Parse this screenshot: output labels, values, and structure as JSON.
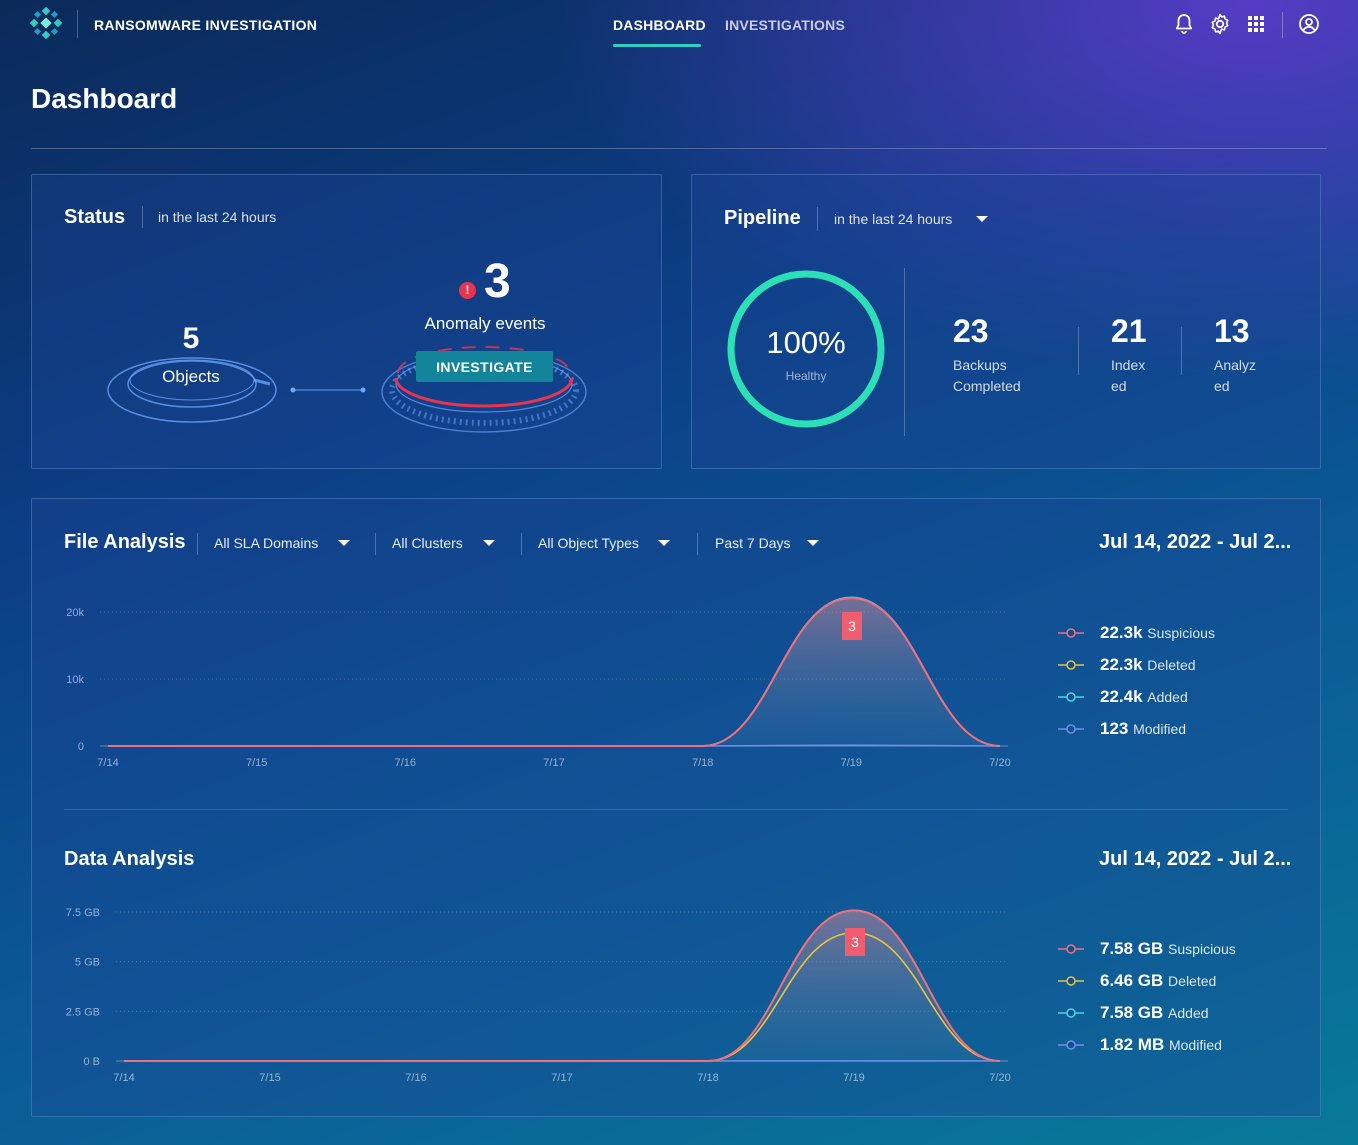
{
  "header": {
    "app_title": "RANSOMWARE INVESTIGATION",
    "tabs": [
      {
        "label": "DASHBOARD",
        "active": true
      },
      {
        "label": "INVESTIGATIONS",
        "active": false
      }
    ],
    "icons": [
      "bell-icon",
      "gear-icon",
      "apps-grid-icon",
      "user-account-icon"
    ]
  },
  "page": {
    "title": "Dashboard"
  },
  "status": {
    "title": "Status",
    "period": "in the last 24 hours",
    "objects_count": "5",
    "objects_label": "Objects",
    "anomaly_alert": "!",
    "anomaly_count": "3",
    "anomaly_label": "Anomaly events",
    "investigate_label": "INVESTIGATE"
  },
  "pipeline": {
    "title": "Pipeline",
    "period": "in the last 24 hours",
    "health_percent": "100%",
    "health_fraction": 1.0,
    "health_label": "Healthy",
    "stats": [
      {
        "value": "23",
        "label_line1": "Backups",
        "label_line2": "Completed"
      },
      {
        "value": "21",
        "label_line1": "Index",
        "label_line2": "ed"
      },
      {
        "value": "13",
        "label_line1": "Analyz",
        "label_line2": "ed"
      }
    ]
  },
  "filters": {
    "sla": "All SLA Domains",
    "clusters": "All Clusters",
    "object_types": "All Object Types",
    "period": "Past 7 Days"
  },
  "file_analysis": {
    "title": "File Analysis",
    "date_range": "Jul 14, 2022 - Jul 2...",
    "marker": "3",
    "legend": [
      {
        "value": "22.3k",
        "name": "Suspicious",
        "color": "#ef6f7d"
      },
      {
        "value": "22.3k",
        "name": "Deleted",
        "color": "#e9c23d"
      },
      {
        "value": "22.4k",
        "name": "Added",
        "color": "#49d4e6"
      },
      {
        "value": "123",
        "name": "Modified",
        "color": "#6f8fe8"
      }
    ]
  },
  "data_analysis": {
    "title": "Data Analysis",
    "date_range": "Jul 14, 2022 - Jul 2...",
    "marker": "3",
    "legend": [
      {
        "value": "7.58 GB",
        "name": "Suspicious",
        "color": "#ef6f7d"
      },
      {
        "value": "6.46 GB",
        "name": "Deleted",
        "color": "#e9c23d"
      },
      {
        "value": "7.58 GB",
        "name": "Added",
        "color": "#49d4e6"
      },
      {
        "value": "1.82 MB",
        "name": "Modified",
        "color": "#6f8fe8"
      }
    ]
  },
  "chart_data": [
    {
      "type": "area",
      "title": "File Analysis",
      "categories": [
        "7/14",
        "7/15",
        "7/16",
        "7/17",
        "7/18",
        "7/19",
        "7/20"
      ],
      "y_ticks": [
        "0",
        "10k",
        "20k"
      ],
      "ylim": [
        0,
        22000
      ],
      "grid": true,
      "series": [
        {
          "name": "Suspicious",
          "values": [
            0,
            0,
            0,
            0,
            0,
            22300,
            0
          ]
        },
        {
          "name": "Deleted",
          "values": [
            0,
            0,
            0,
            0,
            0,
            22300,
            0
          ]
        },
        {
          "name": "Added",
          "values": [
            0,
            0,
            0,
            0,
            0,
            22400,
            0
          ]
        },
        {
          "name": "Modified",
          "values": [
            0,
            0,
            0,
            0,
            0,
            123,
            0
          ]
        }
      ]
    },
    {
      "type": "area",
      "title": "Data Analysis",
      "categories": [
        "7/14",
        "7/15",
        "7/16",
        "7/17",
        "7/18",
        "7/19",
        "7/20"
      ],
      "y_ticks": [
        "0 B",
        "2.5 GB",
        "5 GB",
        "7.5 GB"
      ],
      "ylim": [
        0,
        7.5
      ],
      "grid": true,
      "series": [
        {
          "name": "Suspicious",
          "values": [
            0,
            0,
            0,
            0,
            0,
            7.58,
            0
          ]
        },
        {
          "name": "Deleted",
          "values": [
            0,
            0,
            0,
            0,
            0,
            6.46,
            0
          ]
        },
        {
          "name": "Added",
          "values": [
            0,
            0,
            0,
            0,
            0,
            7.58,
            0
          ]
        },
        {
          "name": "Modified",
          "values": [
            0,
            0,
            0,
            0,
            0,
            0.0018,
            0
          ]
        }
      ]
    }
  ]
}
